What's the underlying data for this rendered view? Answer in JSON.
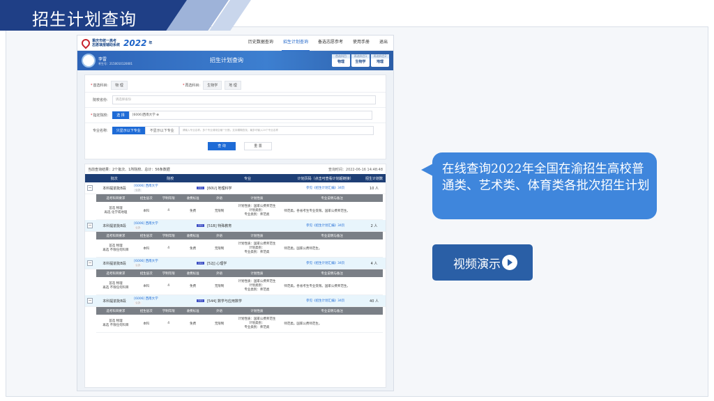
{
  "slide": {
    "title": "招生计划查询"
  },
  "app": {
    "logo_line1": "重庆市统一高考",
    "logo_line2": "志愿填报辅助系统",
    "logo_year": "2022",
    "logo_suffix": "年",
    "nav": [
      "历史数据查询",
      "招生计划查询",
      "备选志愿参考",
      "使用手册",
      "退出"
    ],
    "active_nav": "招生计划查询"
  },
  "banner": {
    "user_name": "李雷",
    "user_id": "考生号：2150010120001",
    "title": "招生计划查询",
    "subjects": [
      {
        "label": "首选科目",
        "value": "物理"
      },
      {
        "label": "再选科目1",
        "value": "生物学"
      },
      {
        "label": "再选科目2",
        "value": "地理"
      }
    ]
  },
  "form": {
    "first_label": "首选科目:",
    "first_value": "物 理",
    "second_label": "再选科目:",
    "second_values": [
      "生物学",
      "地 理"
    ],
    "province_label": "院校省份:",
    "province_placeholder": "请选择省份",
    "school_label": "指定院校:",
    "school_button": "选 择",
    "school_value": "[6006]西南大学",
    "major_label": "专业名称:",
    "major_opt1": "只显示以下专业",
    "major_opt2": "不显示以下专业",
    "major_placeholder": "请输入专业名称。多个专业请用空格\"\"分割。支持模糊查找，最多可输入20个专业名称",
    "search": "查 询",
    "reset": "重 置"
  },
  "results": {
    "summary": "当前查询结果：2个批次、1所院校、总计：56条数据",
    "time": "查询时间：2022-06-16 14:48:48",
    "headers": [
      "批次",
      "院校",
      "专业",
      "计划页码（点击可查看计划超链接）",
      "招生计划数"
    ],
    "sub_headers": [
      "选考科目要求",
      "招生层次",
      "学制年限",
      "收费标准",
      "外语",
      "计划性质",
      "专业说明与备注"
    ],
    "groups": [
      {
        "batch": "本科提前批B段",
        "school_code": "[6006] 西南大学",
        "school_tag": "公办",
        "pill": "211",
        "major": "[60U] 地理科学",
        "ref": "参见《招生计划汇编》34页",
        "count": "10 人",
        "subjects": "首选 物理",
        "subjects2": "再选 化学或地理",
        "level": "本科",
        "years": "4",
        "fee": "免费",
        "lang": "无限制",
        "plan1": "计划性质：国家公费师范生",
        "plan2": "计划类别：",
        "plan3": "专业类别：师范类",
        "note": "师范类。各省考生专业受限。国家公费师范生。"
      },
      {
        "batch": "本科提前批B段",
        "school_code": "[6006] 西南大学",
        "school_tag": "公办",
        "pill": "211",
        "major": "[51B] 特殊教育",
        "ref": "参见《招生计划汇编》34页",
        "count": "2 人",
        "subjects": "首选 物理",
        "subjects2": "再选 不限任何科目",
        "level": "本科",
        "years": "4",
        "fee": "免费",
        "lang": "无限制",
        "plan1": "计划性质：国家公费师范生",
        "plan2": "计划类别：",
        "plan3": "专业类别：师范类",
        "note": "师范类。国家公费师范生。"
      },
      {
        "batch": "本科提前批B段",
        "school_code": "[6006] 西南大学",
        "school_tag": "公办",
        "pill": "211",
        "major": "[52J] 心理学",
        "ref": "参见《招生计划汇编》34页",
        "count": "4 人",
        "subjects": "首选 物理",
        "subjects2": "再选 不限任何科目",
        "level": "本科",
        "years": "4",
        "fee": "免费",
        "lang": "无限制",
        "plan1": "计划性质：国家公费师范生",
        "plan2": "计划类别：",
        "plan3": "专业类别：师范类",
        "note": "师范类。各省考生专业受限。国家公费师范生。"
      },
      {
        "batch": "本科提前批B段",
        "school_code": "[6006] 西南大学",
        "school_tag": "公办",
        "pill": "211",
        "major": "[544] 数学与应用数学",
        "ref": "参见《招生计划汇编》34页",
        "count": "40 人",
        "subjects": "首选 物理",
        "subjects2": "再选 不限任何科目",
        "level": "本科",
        "years": "4",
        "fee": "免费",
        "lang": "无限制",
        "plan1": "计划性质：国家公费师范生",
        "plan2": "计划类别：",
        "plan3": "专业类别：师范类",
        "note": "师范类。国家公费师范生。"
      }
    ]
  },
  "callout": {
    "text": "在线查询2022年全国在渝招生高校普通类、艺术类、体育类各批次招生计划",
    "video_label": "视频演示"
  }
}
